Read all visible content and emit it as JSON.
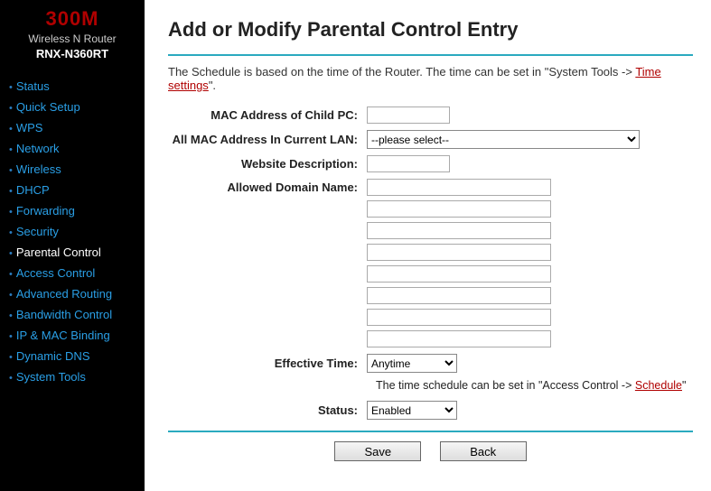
{
  "logo": {
    "top": "300M",
    "mid": "Wireless N Router",
    "bot": "RNX-N360RT"
  },
  "sidebar": {
    "items": [
      {
        "label": "Status",
        "active": false
      },
      {
        "label": "Quick Setup",
        "active": false
      },
      {
        "label": "WPS",
        "active": false
      },
      {
        "label": "Network",
        "active": false
      },
      {
        "label": "Wireless",
        "active": false
      },
      {
        "label": "DHCP",
        "active": false
      },
      {
        "label": "Forwarding",
        "active": false
      },
      {
        "label": "Security",
        "active": false
      },
      {
        "label": "Parental Control",
        "active": true
      },
      {
        "label": "Access Control",
        "active": false
      },
      {
        "label": "Advanced Routing",
        "active": false
      },
      {
        "label": "Bandwidth Control",
        "active": false
      },
      {
        "label": "IP & MAC Binding",
        "active": false
      },
      {
        "label": "Dynamic DNS",
        "active": false
      },
      {
        "label": "System Tools",
        "active": false
      }
    ]
  },
  "page": {
    "title": "Add or Modify Parental Control Entry",
    "info_prefix": "The Schedule is based on the time of the Router. The time can be set in \"System Tools -> ",
    "info_link": "Time settings",
    "info_suffix": "\".",
    "labels": {
      "mac": "MAC Address of Child PC:",
      "allmac": "All MAC Address In Current LAN:",
      "webdesc": "Website Description:",
      "allowed": "Allowed Domain Name:",
      "efftime": "Effective Time:",
      "status": "Status:"
    },
    "values": {
      "mac": "",
      "allmac_selected": "--please select--",
      "webdesc": "",
      "domains": [
        "",
        "",
        "",
        "",
        "",
        "",
        "",
        ""
      ],
      "efftime_selected": "Anytime",
      "status_selected": "Enabled"
    },
    "note_prefix": "The time schedule can be set in \"Access Control -> ",
    "note_link": "Schedule",
    "note_suffix": "\"",
    "buttons": {
      "save": "Save",
      "back": "Back"
    }
  }
}
